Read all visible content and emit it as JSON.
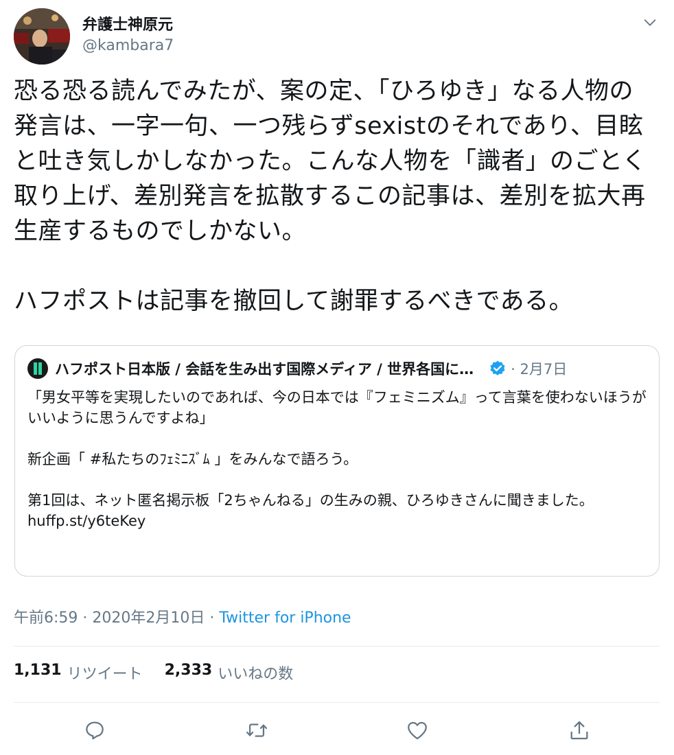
{
  "author": {
    "name": "弁護士神原元",
    "handle": "@kambara7"
  },
  "tweet": {
    "text": "恐る恐る読んでみたが、案の定、「ひろゆき」なる人物の発言は、一字一句、一つ残らずsexistのそれであり、目眩と吐き気しかしなかった。こんな人物を「識者」のごとく取り上げ、差別発言を拡散するこの記事は、差別を拡大再生産するものでしかない。\n\nハフポストは記事を撤回して謝罪するべきである。"
  },
  "quoted_tweet": {
    "name": "ハフポスト日本版 / 会話を生み出す国際メディア / 世界各国に…",
    "date": "· 2月7日",
    "text": "「男女平等を実現したいのであれば、今の日本では『フェミニズム』って言葉を使わないほうがいいように思うんですよね」\n\n新企画「 #私たちのﾌｪﾐﾆｽﾞﾑ 」をみんなで語ろう。\n\n第1回は、ネット匿名掲示板「2ちゃんねる」の生みの親、ひろゆきさんに聞きました。\nhuffp.st/y6teKey"
  },
  "meta": {
    "time": "午前6:59 · 2020年2月10日 · ",
    "source": "Twitter for iPhone"
  },
  "stats": {
    "retweets_count": "1,131",
    "retweets_label": "リツイート",
    "likes_count": "2,333",
    "likes_label": "いいねの数"
  },
  "icons": {
    "more": "chevron-down-icon",
    "reply": "reply-icon",
    "retweet": "retweet-icon",
    "like": "heart-icon",
    "share": "share-icon",
    "verified": "verified-badge-icon"
  },
  "colors": {
    "text": "#14171a",
    "secondary": "#657786",
    "link": "#1b95e0",
    "border": "#ccd6dd",
    "divider": "#e6ecf0"
  }
}
